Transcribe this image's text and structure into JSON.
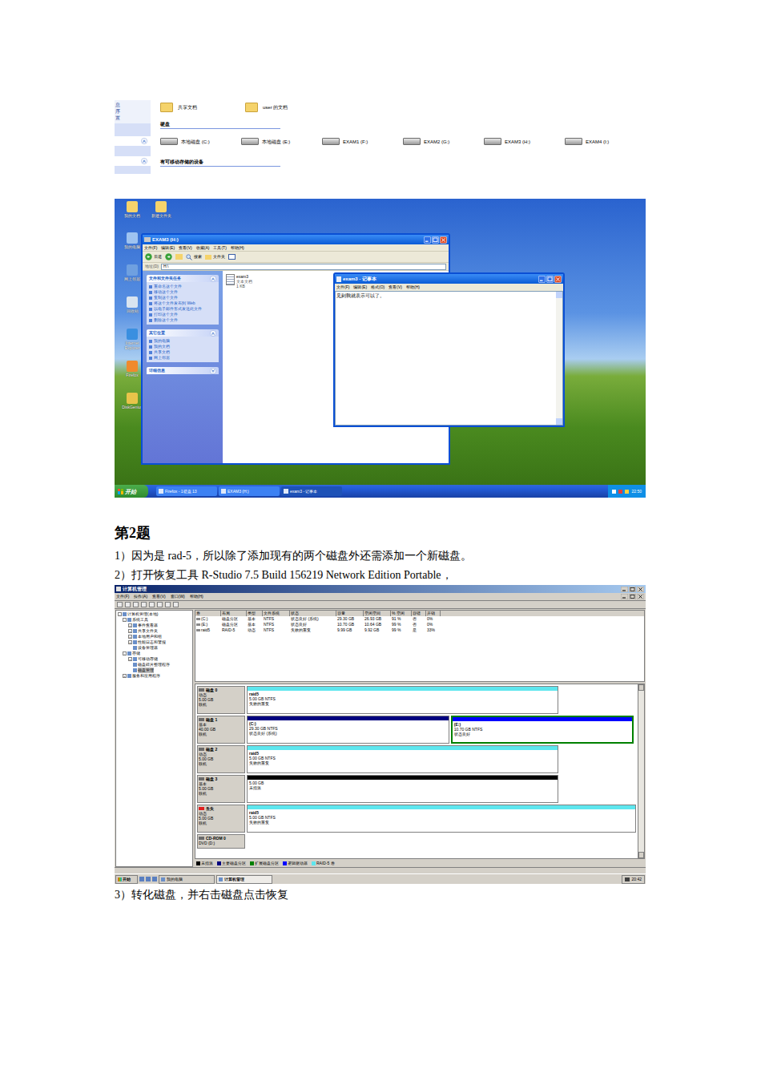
{
  "document": {
    "heading": "第2题",
    "steps_before_figure": [
      "1）因为是 rad-5，所以除了添加现有的两个磁盘外还需添加一个新磁盘。",
      "2）打开恢复工具 R-Studio 7.5 Build 156219 Network Edition Portable，"
    ],
    "step_after_figure": "3）转化磁盘，并右击磁盘点击恢复"
  },
  "my_computer": {
    "sidebar_fragments": [
      "息",
      "序",
      "置"
    ],
    "folders": [
      "共享文档",
      "user 的文档"
    ],
    "hard_disk_heading": "硬盘",
    "drives": [
      "本地磁盘 (C:)",
      "本地磁盘 (E:)",
      "EXAM1 (F:)",
      "EXAM2 (G:)",
      "EXAM3 (H:)",
      "EXAM4 (I:)"
    ],
    "removable_heading": "有可移动存储的设备"
  },
  "desktop": {
    "icons": [
      "我的文档",
      "新建文件夹",
      "我的电脑",
      "网上邻居",
      "回收站",
      "Internet Explorer",
      "Firefox",
      "DiskGenius"
    ],
    "explorer": {
      "title": "EXAM3 (H:)",
      "menu": [
        "文件(F)",
        "编辑(E)",
        "查看(V)",
        "收藏(A)",
        "工具(T)",
        "帮助(H)"
      ],
      "toolbar": [
        "后退",
        "搜索",
        "文件夹"
      ],
      "address_label": "地址(D)",
      "address": "H:\\",
      "panels": [
        {
          "title": "文件和文件夹任务",
          "expanded": true,
          "items": [
            "重命名这个文件",
            "移动这个文件",
            "复制这个文件",
            "将这个文件发布到 Web",
            "以电子邮件形式发送此文件",
            "打印这个文件",
            "删除这个文件"
          ]
        },
        {
          "title": "其它位置",
          "expanded": true,
          "items": [
            "我的电脑",
            "我的文档",
            "共享文档",
            "网上邻居"
          ]
        },
        {
          "title": "详细信息",
          "expanded": false,
          "items": []
        }
      ],
      "file": {
        "name": "exam3",
        "type": "文本文档",
        "size": "1 KB"
      }
    },
    "notepad": {
      "title": "exam3 - 记事本",
      "menu": [
        "文件(F)",
        "编辑(E)",
        "格式(O)",
        "查看(V)",
        "帮助(H)"
      ],
      "content": "见到我就表示可以了。"
    },
    "taskbar": {
      "start": "开始",
      "tasks": [
        {
          "label": "Firefox - 1硬盘 13",
          "selected": false
        },
        {
          "label": "EXAM3 (H:)",
          "selected": false
        },
        {
          "label": "exam3 - 记事本",
          "selected": true
        }
      ],
      "clock": "22:50"
    }
  },
  "computer_management": {
    "title": "计算机管理",
    "menu": [
      "文件(F)",
      "操作(A)",
      "查看(V)",
      "窗口(W)",
      "帮助(H)"
    ],
    "tree": [
      {
        "label": "计算机管理(本地)",
        "depth": 0,
        "toggle": "-",
        "selected": false
      },
      {
        "label": "系统工具",
        "depth": 1,
        "toggle": "-",
        "selected": false
      },
      {
        "label": "事件查看器",
        "depth": 2,
        "toggle": "+",
        "selected": false
      },
      {
        "label": "共享文件夹",
        "depth": 2,
        "toggle": "+",
        "selected": false
      },
      {
        "label": "本地用户和组",
        "depth": 2,
        "toggle": "+",
        "selected": false
      },
      {
        "label": "性能日志和警报",
        "depth": 2,
        "toggle": "+",
        "selected": false
      },
      {
        "label": "设备管理器",
        "depth": 2,
        "toggle": "",
        "selected": false
      },
      {
        "label": "存储",
        "depth": 1,
        "toggle": "-",
        "selected": false
      },
      {
        "label": "可移动存储",
        "depth": 2,
        "toggle": "+",
        "selected": false
      },
      {
        "label": "磁盘碎片整理程序",
        "depth": 2,
        "toggle": "",
        "selected": false
      },
      {
        "label": "磁盘管理",
        "depth": 2,
        "toggle": "",
        "selected": true
      },
      {
        "label": "服务和应用程序",
        "depth": 1,
        "toggle": "+",
        "selected": false
      }
    ],
    "volume_columns": [
      "卷",
      "布局",
      "类型",
      "文件系统",
      "状态",
      "容量",
      "空闲空间",
      "% 空闲",
      "容错",
      "开销"
    ],
    "volumes": [
      [
        "(C:)",
        "磁盘分区",
        "基本",
        "NTFS",
        "状态良好 (系统)",
        "29.30 GB",
        "26.93 GB",
        "91 %",
        "否",
        "0%"
      ],
      [
        "(E:)",
        "磁盘分区",
        "基本",
        "NTFS",
        "状态良好",
        "10.70 GB",
        "10.64 GB",
        "99 %",
        "否",
        "0%"
      ],
      [
        "raid5",
        "RAID-5",
        "动态",
        "NTFS",
        "失败的重复",
        "9.99 GB",
        "9.92 GB",
        "99 %",
        "是",
        "33%"
      ]
    ],
    "disks": [
      {
        "name": "磁盘 0",
        "info": [
          "动态",
          "5.00 GB",
          "联机"
        ],
        "missing": false,
        "partitions": [
          {
            "lines": [
              "raid5",
              "5.00 GB NTFS",
              "失败的重复"
            ],
            "color": "#5ee6ee",
            "selected": false
          }
        ]
      },
      {
        "name": "磁盘 1",
        "info": [
          "基本",
          "40.00 GB",
          "联机"
        ],
        "missing": false,
        "partitions": [
          {
            "lines": [
              "(C:)",
              "29.30 GB NTFS",
              "状态良好 (系统)"
            ],
            "color": "#00007f",
            "selected": false
          },
          {
            "lines": [
              "(E:)",
              "10.70 GB NTFS",
              "状态良好"
            ],
            "color": "#0000ff",
            "selected": true
          }
        ]
      },
      {
        "name": "磁盘 2",
        "info": [
          "动态",
          "5.00 GB",
          "联机"
        ],
        "missing": false,
        "partitions": [
          {
            "lines": [
              "raid5",
              "5.00 GB NTFS",
              "失败的重复"
            ],
            "color": "#5ee6ee",
            "selected": false
          }
        ]
      },
      {
        "name": "磁盘 3",
        "info": [
          "基本",
          "5.00 GB",
          "联机"
        ],
        "missing": false,
        "partitions": [
          {
            "lines": [
              "5.00 GB",
              "未指派"
            ],
            "color": "#000000",
            "selected": false
          }
        ]
      },
      {
        "name": "丢失",
        "info": [
          "动态",
          "5.00 GB",
          "联机"
        ],
        "missing": true,
        "partitions": [
          {
            "lines": [
              "raid5",
              "5.00 GB NTFS",
              "失败的重复"
            ],
            "color": "#5ee6ee",
            "selected": false
          }
        ]
      },
      {
        "name": "CD-ROM 0",
        "info": [
          "DVD (D:)"
        ],
        "missing": false,
        "partitions": []
      }
    ],
    "legend": [
      {
        "label": "未指派",
        "color": "#000000"
      },
      {
        "label": "主要磁盘分区",
        "color": "#00007f"
      },
      {
        "label": "扩展磁盘分区",
        "color": "#008000"
      },
      {
        "label": "逻辑驱动器",
        "color": "#0000ff"
      },
      {
        "label": "RAID-5 卷",
        "color": "#5ee6ee"
      }
    ],
    "taskbar": {
      "start": "开始",
      "tasks": [
        {
          "label": "我的电脑",
          "selected": false
        },
        {
          "label": "计算机管理",
          "selected": true
        }
      ],
      "clock": "20:42"
    }
  }
}
